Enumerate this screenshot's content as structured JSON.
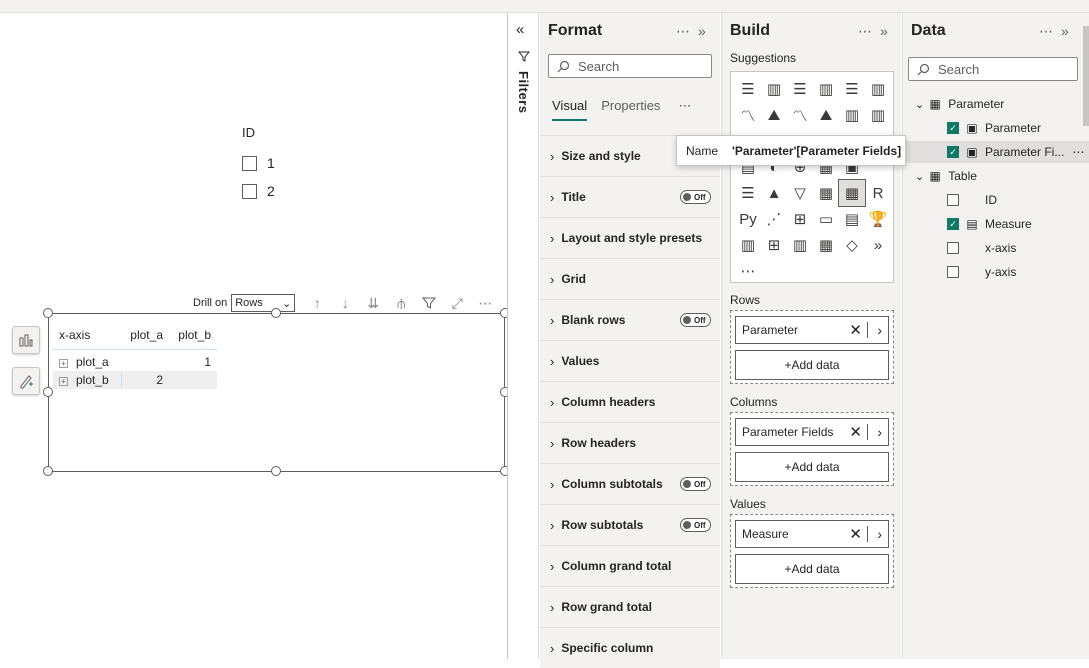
{
  "slicer": {
    "title": "ID",
    "items": [
      "1",
      "2"
    ]
  },
  "visual_header": {
    "drill_label": "Drill on",
    "drill_value": "Rows"
  },
  "matrix": {
    "headers": [
      "x-axis",
      "plot_a",
      "plot_b"
    ],
    "rows": [
      {
        "label": "plot_a",
        "plot_a": "",
        "plot_b": "1"
      },
      {
        "label": "plot_b",
        "plot_a": "2",
        "plot_b": ""
      }
    ]
  },
  "filters": {
    "label": "Filters"
  },
  "format_pane": {
    "title": "Format",
    "search_placeholder": "Search",
    "tabs": [
      "Visual",
      "Properties"
    ],
    "more": "⋯",
    "sections": [
      {
        "label": "Size and style",
        "toggle": ""
      },
      {
        "label": "Title",
        "toggle": "Off"
      },
      {
        "label": "Layout and style presets",
        "toggle": ""
      },
      {
        "label": "Grid",
        "toggle": ""
      },
      {
        "label": "Blank rows",
        "toggle": "Off"
      },
      {
        "label": "Values",
        "toggle": ""
      },
      {
        "label": "Column headers",
        "toggle": ""
      },
      {
        "label": "Row headers",
        "toggle": ""
      },
      {
        "label": "Column subtotals",
        "toggle": "Off"
      },
      {
        "label": "Row subtotals",
        "toggle": "Off"
      },
      {
        "label": "Column grand total",
        "toggle": ""
      },
      {
        "label": "Row grand total",
        "toggle": ""
      },
      {
        "label": "Specific column",
        "toggle": ""
      }
    ]
  },
  "build_pane": {
    "title": "Build",
    "suggestions_label": "Suggestions",
    "wells": [
      {
        "label": "Rows",
        "field": "Parameter",
        "add": "+Add data"
      },
      {
        "label": "Columns",
        "field": "Parameter Fields",
        "add": "+Add data"
      },
      {
        "label": "Values",
        "field": "Measure",
        "add": "+Add data"
      }
    ]
  },
  "data_pane": {
    "title": "Data",
    "search_placeholder": "Search",
    "tables": [
      {
        "name": "Parameter",
        "fields": [
          {
            "name": "Parameter",
            "checked": true
          },
          {
            "name": "Parameter Fi...",
            "checked": true
          }
        ]
      },
      {
        "name": "Table",
        "fields": [
          {
            "name": "ID",
            "checked": false
          },
          {
            "name": "Measure",
            "checked": true
          },
          {
            "name": "x-axis",
            "checked": false
          },
          {
            "name": "y-axis",
            "checked": false
          }
        ]
      }
    ]
  },
  "tooltip": {
    "key": "Name",
    "value": "'Parameter'[Parameter Fields]"
  },
  "colors": {
    "accent": "#117865",
    "pane_bg": "#f3f2f1"
  }
}
